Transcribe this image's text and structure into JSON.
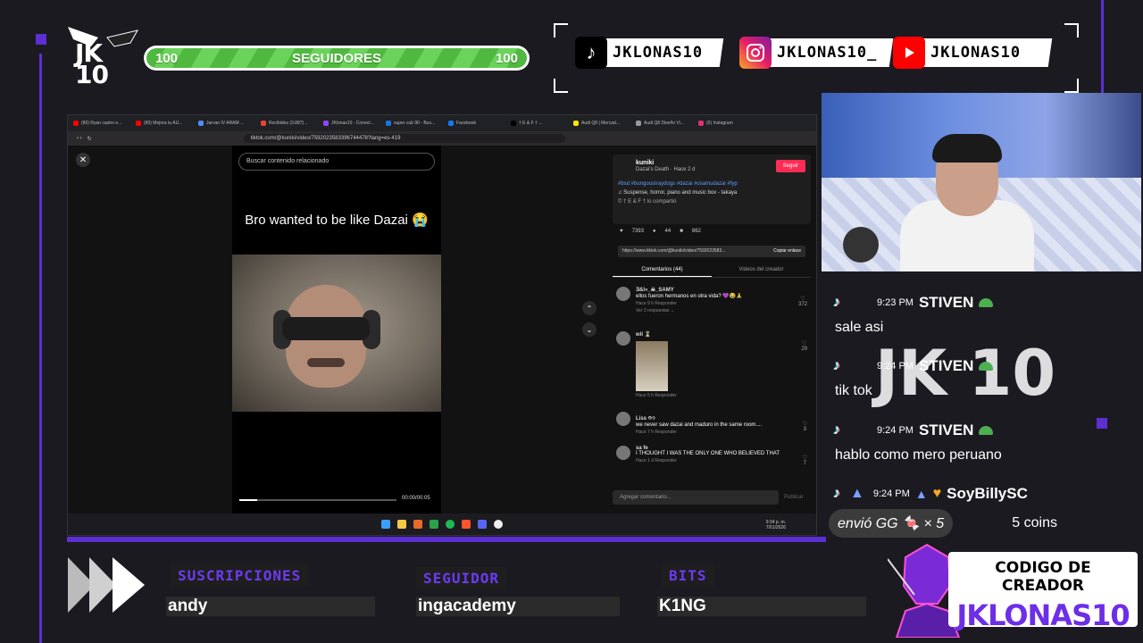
{
  "overlay": {
    "logo_text": "JK 10",
    "goal": {
      "left_count": "100",
      "label": "SEGUIDORES",
      "right_count": "100",
      "progress": 1.0
    },
    "socials": [
      {
        "platform": "tiktok-icon",
        "handle": "JKLONAS10"
      },
      {
        "platform": "instagram-icon",
        "handle": "JKLONAS10_"
      },
      {
        "platform": "youtube-icon",
        "handle": "JKLONAS10"
      }
    ],
    "bottom": {
      "subs_label": "SUSCRIPCIONES",
      "subs_value": "andy",
      "follower_label": "SEGUIDOR",
      "follower_value": "ingacademy",
      "bits_label": "BITS",
      "bits_value": "K1NG"
    },
    "creator_code": {
      "title": "CODIGO DE CREADOR",
      "name": "JKLONAS10"
    }
  },
  "browser": {
    "tabs": [
      "(86) Ryan castro e...",
      "(86) Mejora tu AU...",
      "Jarvan IV ARAM ...",
      "Recibidos (3.887)...",
      "JKlonas10 - Conect...",
      "super cub 90 - Bus...",
      "Facebook",
      "† E & F † ...",
      "Audi Q8 | Mercad...",
      "Audi Q8 Diseño Vi...",
      "(6) Instagram"
    ],
    "url": "tiktok.com/@kuniki/video/7592023583396744478?lang=es-419",
    "search_placeholder": "Buscar contenido relacionado",
    "caption": "Bro wanted to be like Dazai 😭",
    "video_time": "00:00/00:05",
    "post": {
      "user": "kuniki",
      "subtitle": "Dazai's Death · Hace 2 d",
      "follow": "Seguir",
      "tags": "#bsd #bungoustraydogs #dazai #osamudazai #fyp",
      "music": "♫  Suspense, horror, piano and music box - takaya",
      "shared": "© † E & F † lo compartió"
    },
    "stats": {
      "likes": "7393",
      "comments": "44",
      "saves": "862"
    },
    "link": {
      "url": "https://www.tiktok.com/@kuniki/video/7592023583...",
      "copy": "Copiar enlace"
    },
    "comment_tabs": {
      "comments": "Comentarios (44)",
      "creator_videos": "Videos del creador"
    },
    "comments": [
      {
        "user": "Ǝ&l»_☠_SAMY",
        "text": "ellos fueron hermanos en otra vida? 💜😂🙏",
        "meta": "Hace 9 h   Responder",
        "likes": "372",
        "replies": "Ver 3 respuestas ⌄"
      },
      {
        "user": "wil ⌛",
        "text": "",
        "meta": "Hace 5 h   Responder",
        "likes": "29"
      },
      {
        "user": "Liss ᡣ𐭩",
        "text": "we never saw dazai and maduro in the same room....",
        "meta": "Hace 7 h   Responder",
        "likes": "3"
      },
      {
        "user": "sa fe",
        "text": "I THOUGHT I WAS THE ONLY ONE WHO BELIEVED THAT",
        "meta": "Hace 1 d   Responder",
        "likes": "7"
      }
    ],
    "add_comment": "Agregar comentario...",
    "publish": "Publicar",
    "clock": {
      "time": "9:34 p. m.",
      "date": "7/01/2026"
    }
  },
  "chat": {
    "messages": [
      {
        "time": "9:23 PM",
        "user": "STIVEN",
        "text": "sale asi"
      },
      {
        "time": "9:24 PM",
        "user": "STIVEN",
        "text": "tik tok"
      },
      {
        "time": "9:24 PM",
        "user": "STIVEN",
        "text": "hablo como mero peruano"
      },
      {
        "time": "9:24 PM",
        "user": "SoyBillySC",
        "text": ""
      }
    ],
    "gift_text": "envió GG 🍬 × 5",
    "gift_coins": "5 coins"
  },
  "colors": {
    "accent": "#5b2fd1",
    "green": "#4fb83f",
    "tiktok_red": "#fe2c55",
    "creator_purple": "#6d2ee8"
  }
}
